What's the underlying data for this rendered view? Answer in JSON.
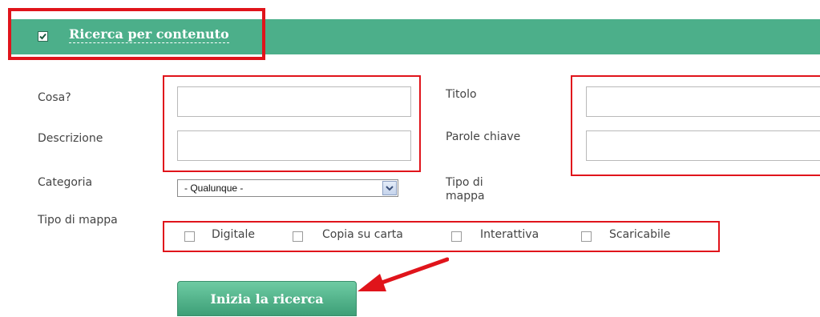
{
  "header": {
    "title": "Ricerca per contenuto",
    "checked": true,
    "bar_color": "#4caf8a"
  },
  "form": {
    "cosa": {
      "label": "Cosa?",
      "value": ""
    },
    "descrizione": {
      "label": "Descrizione",
      "value": ""
    },
    "titolo": {
      "label": "Titolo",
      "value": ""
    },
    "parole_chiave": {
      "label": "Parole chiave",
      "value": ""
    },
    "categoria": {
      "label": "Categoria",
      "selected": "- Qualunque -"
    },
    "tipo_di_mappa_right": {
      "label": "Tipo di mappa"
    },
    "tipo_di_mappa": {
      "label": "Tipo di mappa",
      "options": [
        {
          "label": "Digitale",
          "checked": false
        },
        {
          "label": "Copia su carta",
          "checked": false
        },
        {
          "label": "Interattiva",
          "checked": false
        },
        {
          "label": "Scaricabile",
          "checked": false
        }
      ]
    }
  },
  "actions": {
    "search_label": "Inizia la ricerca"
  },
  "annotations": {
    "highlight_color": "#e0141b"
  }
}
